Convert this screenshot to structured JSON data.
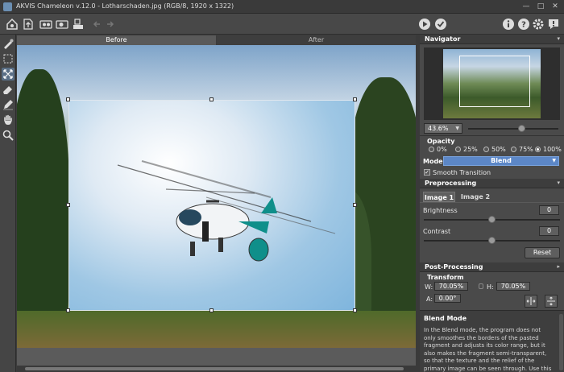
{
  "window": {
    "title": "AKVIS Chameleon v.12.0 - Lotharschaden.jpg (RGB/8, 1920 x 1322)",
    "controls": [
      "—",
      "□",
      "✕"
    ]
  },
  "toolbar": {
    "left_icons": [
      "home-icon",
      "open-icon",
      "save-icon",
      "batch-icon",
      "batch-settings-icon",
      "print-icon",
      "undo-icon",
      "redo-icon"
    ],
    "right_icons": [
      "run-icon",
      "apply-icon",
      "info-icon",
      "help-icon",
      "settings-icon",
      "tips-icon"
    ]
  },
  "tools": [
    "brush-icon",
    "selection-icon",
    "transform-icon",
    "eraser-icon",
    "pencil-icon",
    "hand-icon",
    "zoom-icon"
  ],
  "tabs": {
    "before": "Before",
    "after": "After"
  },
  "navigator": {
    "title": "Navigator",
    "zoom": "43.6%",
    "zoom_level": 0.6
  },
  "opacity": {
    "label": "Opacity",
    "options": [
      "0%",
      "25%",
      "50%",
      "75%",
      "100%"
    ],
    "selected": "100%"
  },
  "mode": {
    "label": "Mode",
    "value": "Blend"
  },
  "smooth_transition": {
    "label": "Smooth Transition",
    "checked": true
  },
  "preprocessing": {
    "title": "Preprocessing",
    "tabs": [
      "Image 1",
      "Image 2"
    ],
    "active_tab": "Image 1",
    "brightness": {
      "label": "Brightness",
      "value": "0",
      "level": 0.5
    },
    "contrast": {
      "label": "Contrast",
      "value": "0",
      "level": 0.5
    },
    "reset": "Reset"
  },
  "post_processing": {
    "title": "Post-Processing"
  },
  "transform": {
    "title": "Transform",
    "w_label": "W:",
    "w_value": "70.05%",
    "h_label": "H:",
    "h_value": "70.05%",
    "a_label": "A:",
    "a_value": "0.00°"
  },
  "help": {
    "title": "Blend Mode",
    "body": "In the Blend mode, the program does not only smoothes the borders of the pasted fragment and adjusts its color range, but it also makes the fragment semi-transparent, so that the texture and the relief of the primary image can be seen through. Use this mode if you want to \"dissolve\""
  },
  "colors": {
    "accent": "#5c87c7",
    "panel_bg": "#4a4a4a",
    "toolbar_bg": "#484848"
  }
}
